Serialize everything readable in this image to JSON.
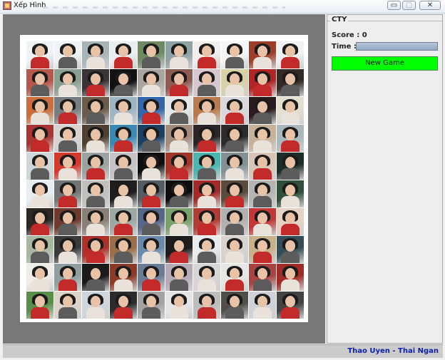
{
  "window": {
    "title": "Xếp Hình"
  },
  "panel": {
    "group_title": "CTY",
    "score_label": "Score :",
    "score_value": "0",
    "time_label": "Time :",
    "time_progress": 1.0,
    "new_game_label": "New Game",
    "colors": {
      "new_game_bg": "#00ff00",
      "board_bg": "#787878"
    }
  },
  "status": {
    "credit": "Thao Uyen - Thai Ngan"
  },
  "tiles": [
    [
      "#eef3f5",
      "#eef3f5",
      "#a9b4b8",
      "#e9eef0",
      "#6f8a63",
      "#8fa2a6",
      "#f1eeeb",
      "#f6f6f6",
      "#9d3d2a",
      "#eef2f4"
    ],
    [
      "#b5574a",
      "#8a9f8f",
      "#3a3337",
      "#121212",
      "#a9a59f",
      "#8f5a52",
      "#d7c5cf",
      "#d9d1a6",
      "#b12524",
      "#312a25"
    ],
    [
      "#cc6d3d",
      "#777d80",
      "#6c5a4a",
      "#9eb4c3",
      "#3366aa",
      "#e6e8e8",
      "#bb7a4f",
      "#d9d9dd",
      "#2b1b1e",
      "#e3e0cf"
    ],
    [
      "#a93432",
      "#d8d3cf",
      "#4f4032",
      "#3a89b5",
      "#1b3f63",
      "#a38b7b",
      "#2c2527",
      "#2b2b2b",
      "#c7b199",
      "#aab8bd"
    ],
    [
      "#cfd8d8",
      "#d23a2d",
      "#9aa3a2",
      "#c7c3c4",
      "#0e0e0e",
      "#a23628",
      "#4bb5b0",
      "#839094",
      "#d9c5b5",
      "#1d2d2a"
    ],
    [
      "#e6eef1",
      "#727373",
      "#c2bfbd",
      "#1e1e1e",
      "#565d62",
      "#0d0d0d",
      "#a42a29",
      "#5a4b3a",
      "#b6b4b1",
      "#2f4f3a"
    ],
    [
      "#2f2722",
      "#6f3a2d",
      "#8a7f77",
      "#9ea8a3",
      "#556688",
      "#7aa06b",
      "#b23c33",
      "#b2b1b1",
      "#c33737",
      "#e6d2c2"
    ],
    [
      "#a8b7a0",
      "#3a3a3a",
      "#b02f28",
      "#9a6e49",
      "#6b89ad",
      "#1d1d1d",
      "#e9ecec",
      "#d8d3ce",
      "#c8b089",
      "#344d56"
    ],
    [
      "#f0ece8",
      "#8f9fa0",
      "#1a1a1a",
      "#8c3a28",
      "#6b7c95",
      "#b6aab7",
      "#d8d5d6",
      "#e8e6e5",
      "#a84341",
      "#a02c25"
    ],
    [
      "#5a8f4a",
      "#ddd3c9",
      "#cfd6dc",
      "#2c2c2c",
      "#a4a2a3",
      "#e5e5e8",
      "#bdbdbd",
      "#514d49",
      "#cfd2d8",
      "#434343"
    ]
  ]
}
